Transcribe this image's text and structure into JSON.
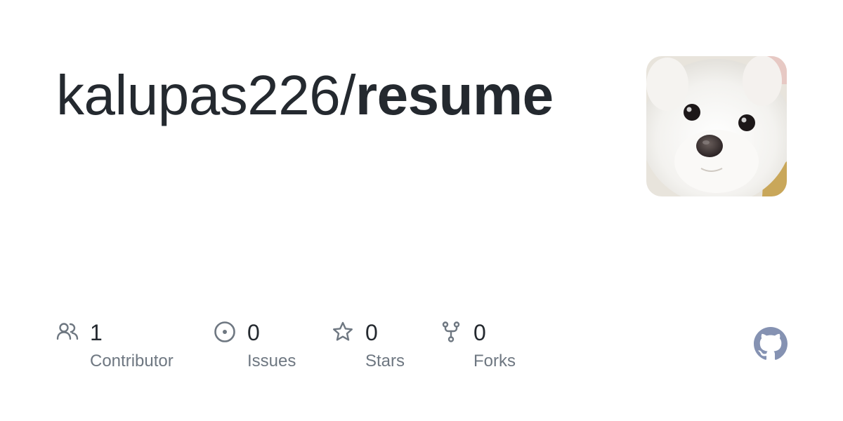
{
  "repo": {
    "owner": "kalupas226",
    "separator": "/",
    "name": "resume"
  },
  "avatar": {
    "alt": "white dog avatar"
  },
  "stats": {
    "contributors": {
      "count": "1",
      "label": "Contributor",
      "icon": "people-icon"
    },
    "issues": {
      "count": "0",
      "label": "Issues",
      "icon": "issue-opened-icon"
    },
    "stars": {
      "count": "0",
      "label": "Stars",
      "icon": "star-icon"
    },
    "forks": {
      "count": "0",
      "label": "Forks",
      "icon": "repo-forked-icon"
    }
  },
  "colors": {
    "text": "#24292f",
    "muted": "#6e7781",
    "icon": "#6e7781",
    "github_logo": "#8592b2"
  }
}
